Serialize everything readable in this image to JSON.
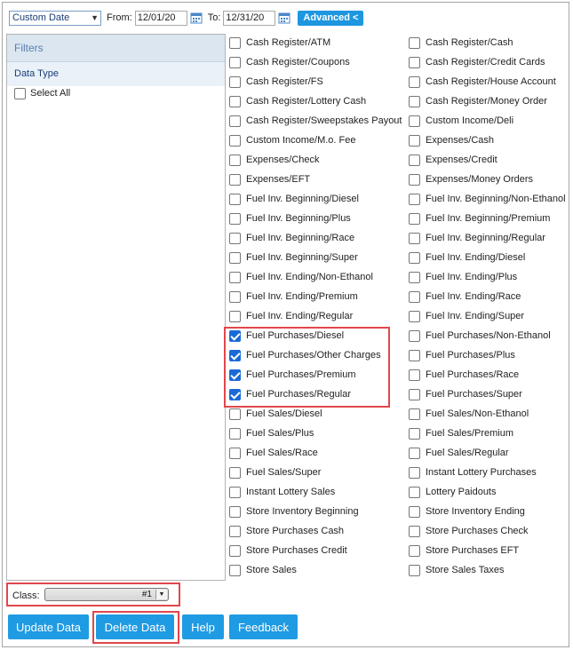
{
  "toolbar": {
    "range_value": "Custom Date",
    "from_label": "From:",
    "from_value": "12/01/20",
    "to_label": "To:",
    "to_value": "12/31/20",
    "advanced_label": "Advanced <"
  },
  "filters": {
    "title": "Filters",
    "section": "Data Type",
    "select_all": "Select All"
  },
  "data_types": [
    {
      "label": "Cash Register/ATM",
      "checked": false
    },
    {
      "label": "Cash Register/Cash",
      "checked": false
    },
    {
      "label": "Cash Register/Coupons",
      "checked": false
    },
    {
      "label": "Cash Register/Credit Cards",
      "checked": false
    },
    {
      "label": "Cash Register/FS",
      "checked": false
    },
    {
      "label": "Cash Register/House Account",
      "checked": false
    },
    {
      "label": "Cash Register/Lottery Cash",
      "checked": false
    },
    {
      "label": "Cash Register/Money Order",
      "checked": false
    },
    {
      "label": "Cash Register/Sweepstakes Payout",
      "checked": false
    },
    {
      "label": "Custom Income/Deli",
      "checked": false
    },
    {
      "label": "Custom Income/M.o. Fee",
      "checked": false
    },
    {
      "label": "Expenses/Cash",
      "checked": false
    },
    {
      "label": "Expenses/Check",
      "checked": false
    },
    {
      "label": "Expenses/Credit",
      "checked": false
    },
    {
      "label": "Expenses/EFT",
      "checked": false
    },
    {
      "label": "Expenses/Money Orders",
      "checked": false
    },
    {
      "label": "Fuel Inv. Beginning/Diesel",
      "checked": false
    },
    {
      "label": "Fuel Inv. Beginning/Non-Ethanol",
      "checked": false
    },
    {
      "label": "Fuel Inv. Beginning/Plus",
      "checked": false
    },
    {
      "label": "Fuel Inv. Beginning/Premium",
      "checked": false
    },
    {
      "label": "Fuel Inv. Beginning/Race",
      "checked": false
    },
    {
      "label": "Fuel Inv. Beginning/Regular",
      "checked": false
    },
    {
      "label": "Fuel Inv. Beginning/Super",
      "checked": false
    },
    {
      "label": "Fuel Inv. Ending/Diesel",
      "checked": false
    },
    {
      "label": "Fuel Inv. Ending/Non-Ethanol",
      "checked": false
    },
    {
      "label": "Fuel Inv. Ending/Plus",
      "checked": false
    },
    {
      "label": "Fuel Inv. Ending/Premium",
      "checked": false
    },
    {
      "label": "Fuel Inv. Ending/Race",
      "checked": false
    },
    {
      "label": "Fuel Inv. Ending/Regular",
      "checked": false
    },
    {
      "label": "Fuel Inv. Ending/Super",
      "checked": false
    },
    {
      "label": "Fuel Purchases/Diesel",
      "checked": true
    },
    {
      "label": "Fuel Purchases/Non-Ethanol",
      "checked": false
    },
    {
      "label": "Fuel Purchases/Other Charges",
      "checked": true
    },
    {
      "label": "Fuel Purchases/Plus",
      "checked": false
    },
    {
      "label": "Fuel Purchases/Premium",
      "checked": true
    },
    {
      "label": "Fuel Purchases/Race",
      "checked": false
    },
    {
      "label": "Fuel Purchases/Regular",
      "checked": true
    },
    {
      "label": "Fuel Purchases/Super",
      "checked": false
    },
    {
      "label": "Fuel Sales/Diesel",
      "checked": false
    },
    {
      "label": "Fuel Sales/Non-Ethanol",
      "checked": false
    },
    {
      "label": "Fuel Sales/Plus",
      "checked": false
    },
    {
      "label": "Fuel Sales/Premium",
      "checked": false
    },
    {
      "label": "Fuel Sales/Race",
      "checked": false
    },
    {
      "label": "Fuel Sales/Regular",
      "checked": false
    },
    {
      "label": "Fuel Sales/Super",
      "checked": false
    },
    {
      "label": "Instant Lottery Purchases",
      "checked": false
    },
    {
      "label": "Instant Lottery Sales",
      "checked": false
    },
    {
      "label": "Lottery Paidouts",
      "checked": false
    },
    {
      "label": "Store Inventory Beginning",
      "checked": false
    },
    {
      "label": "Store Inventory Ending",
      "checked": false
    },
    {
      "label": "Store Purchases Cash",
      "checked": false
    },
    {
      "label": "Store Purchases Check",
      "checked": false
    },
    {
      "label": "Store Purchases Credit",
      "checked": false
    },
    {
      "label": "Store Purchases EFT",
      "checked": false
    },
    {
      "label": "Store Sales",
      "checked": false
    },
    {
      "label": "Store Sales Taxes",
      "checked": false
    }
  ],
  "class_filter": {
    "label": "Class:",
    "value": "#1"
  },
  "buttons": {
    "update": "Update Data",
    "delete": "Delete Data",
    "help": "Help",
    "feedback": "Feedback"
  },
  "icons": {
    "calendar": "calendar-icon",
    "dropdown": "chevron-down-icon"
  },
  "colors": {
    "accent": "#1f9be3",
    "highlight": "#e0474c",
    "checked": "#1a6ad6"
  }
}
